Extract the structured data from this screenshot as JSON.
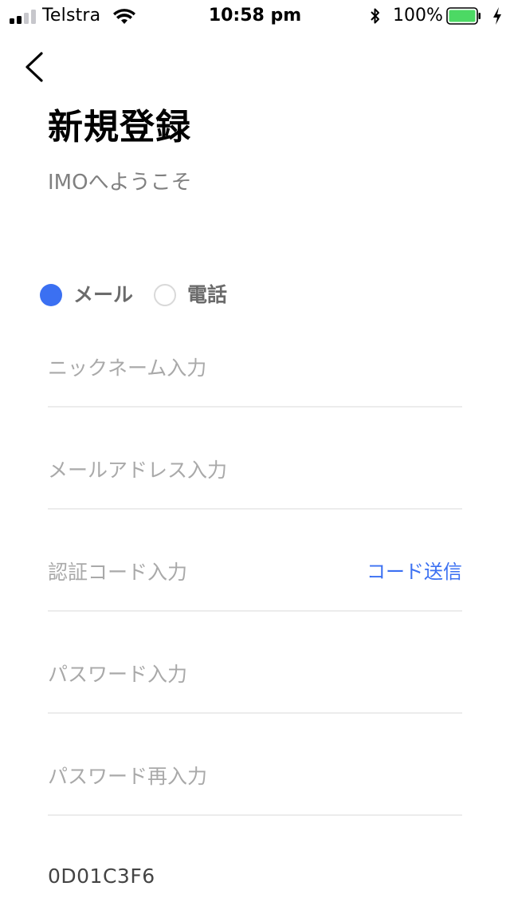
{
  "status_bar": {
    "carrier": "Telstra",
    "time": "10:58 pm",
    "battery_percent": "100%",
    "signal_bars_filled": 2,
    "signal_bars_total": 4,
    "battery_level": 1.0,
    "battery_color": "#4cd964"
  },
  "nav": {
    "back_icon": "chevron-left-icon"
  },
  "header": {
    "title": "新規登録",
    "subtitle": "IMOへようこそ"
  },
  "register_method": {
    "options": [
      {
        "label": "メール",
        "selected": true
      },
      {
        "label": "電話",
        "selected": false
      }
    ]
  },
  "form": {
    "nickname": {
      "placeholder": "ニックネーム入力",
      "value": ""
    },
    "email": {
      "placeholder": "メールアドレス入力",
      "value": ""
    },
    "verification_code": {
      "placeholder": "認証コード入力",
      "value": "",
      "send_label": "コード送信"
    },
    "password": {
      "placeholder": "パスワード入力",
      "value": ""
    },
    "password_confirm": {
      "placeholder": "パスワード再入力",
      "value": ""
    }
  },
  "footer": {
    "code": "0D01C3F6"
  },
  "colors": {
    "accent": "#3b70f2",
    "placeholder": "#a9a9a9",
    "divider": "#ececec",
    "radio_label": "#6b6b6b"
  }
}
